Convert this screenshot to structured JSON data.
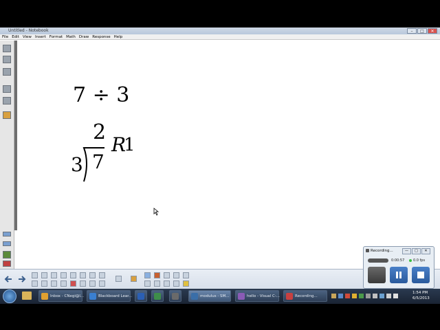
{
  "window": {
    "title": "Untitled - Notebook",
    "controls": [
      "–",
      "□",
      "✕"
    ]
  },
  "menu": [
    "File",
    "Edit",
    "View",
    "Insert",
    "Format",
    "Math",
    "Draw",
    "Response",
    "Help"
  ],
  "canvas": {
    "expression": "7 ÷ 3",
    "divisor": "3",
    "dividend": "7",
    "quotient": "2",
    "remainder_letter": "R",
    "remainder_value": "1"
  },
  "recorder": {
    "title": "Recording...",
    "time": "0:00:57",
    "fps": "0.0 fps",
    "controls": [
      "—",
      "□",
      "✕"
    ]
  },
  "taskbar": {
    "tasks": [
      {
        "label": "Inbox - CNegi@l...",
        "color": "#e0a030"
      },
      {
        "label": "Blackboard Lear...",
        "color": "#3a7fd0"
      },
      {
        "label": "",
        "color": "#2b5fb4"
      },
      {
        "label": "",
        "color": "#3e8e4a"
      },
      {
        "label": "",
        "color": "#6a6a6a"
      },
      {
        "label": "modulus - SM...",
        "color": "#3a6ea8"
      },
      {
        "label": "hello - Visual C-...",
        "color": "#8a5bb5"
      },
      {
        "label": "Recording...",
        "color": "#c84040"
      }
    ],
    "time": "1:54 PM",
    "date": "6/5/2013"
  }
}
